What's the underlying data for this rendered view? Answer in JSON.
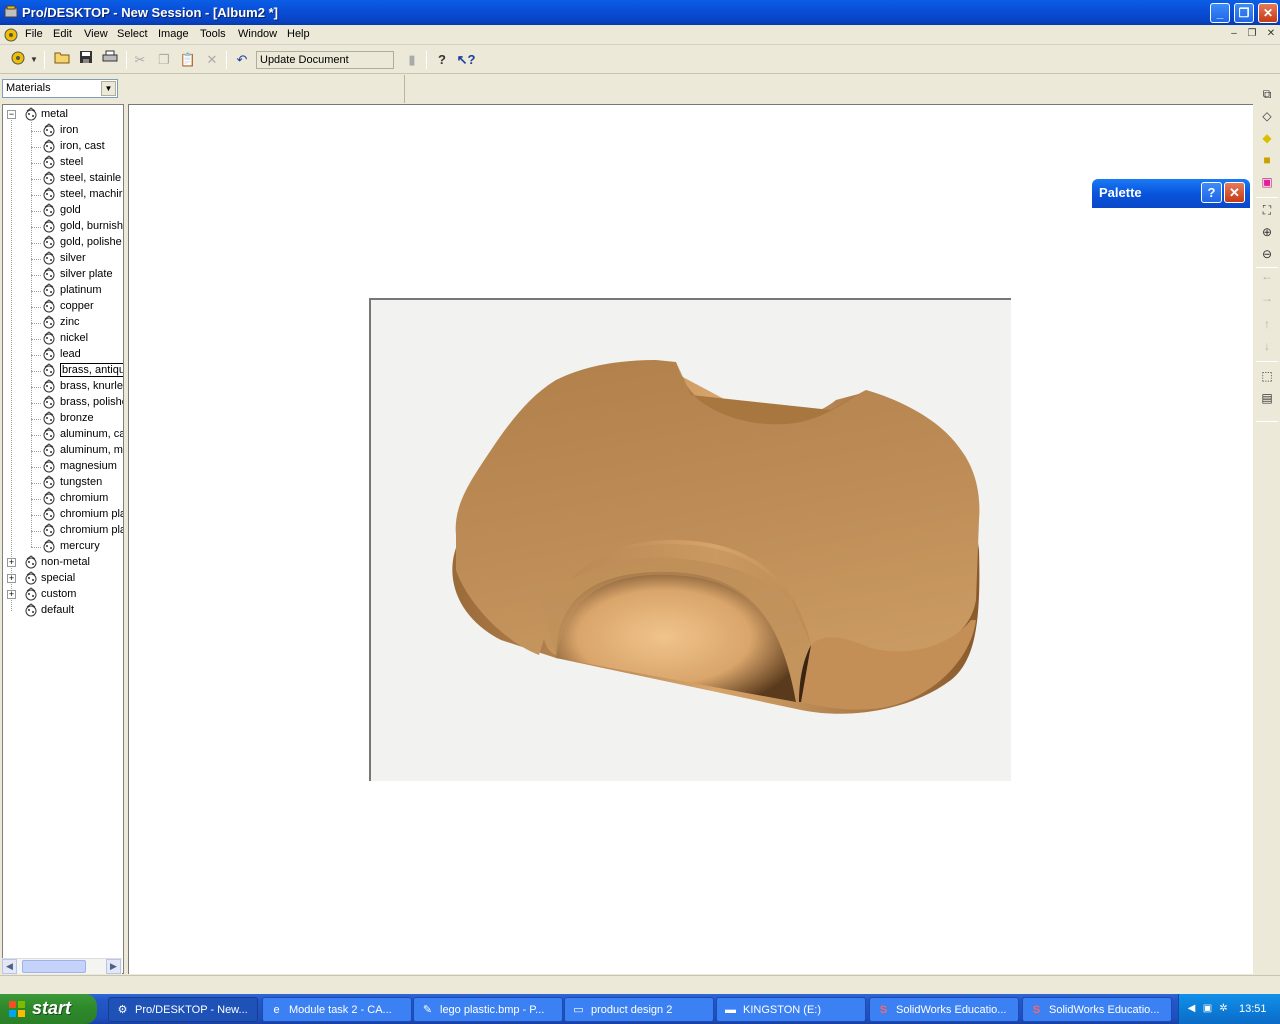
{
  "window": {
    "title": "Pro/DESKTOP - New Session - [Album2 *]",
    "controls": {
      "minimize": "_",
      "maximize": "❐",
      "close": "✕"
    }
  },
  "menu": {
    "items": [
      "File",
      "Edit",
      "View",
      "Select",
      "Image",
      "Tools",
      "Window",
      "Help"
    ],
    "mdi_controls": {
      "minimize": "–",
      "restore": "❐",
      "close": "✕"
    }
  },
  "toolbar": {
    "update_document": "Update Document"
  },
  "materials_combo": {
    "selected": "Materials"
  },
  "tree": {
    "groups": [
      {
        "label": "metal",
        "expanded": true,
        "children": [
          "iron",
          "iron, cast",
          "steel",
          "steel, stainle",
          "steel, machir",
          "gold",
          "gold, burnish",
          "gold, polishe",
          "silver",
          "silver plate",
          "platinum",
          "copper",
          "zinc",
          "nickel",
          "lead",
          "brass, antique",
          "brass, knurle",
          "brass, polishe",
          "bronze",
          "aluminum, ca",
          "aluminum, ma",
          "magnesium",
          "tungsten",
          "chromium",
          "chromium pla",
          "chromium pla",
          "mercury"
        ]
      },
      {
        "label": "non-metal",
        "expanded": false
      },
      {
        "label": "special",
        "expanded": false
      },
      {
        "label": "custom",
        "expanded": false
      },
      {
        "label": "default",
        "expanded": false
      }
    ],
    "selected_item": "brass, antique"
  },
  "palette": {
    "title": "Palette",
    "help": "?",
    "close": "✕"
  },
  "render": {
    "material_color": "#c8935a",
    "background": "#f2f2f0"
  },
  "taskbar": {
    "start_label": "start",
    "tasks": [
      {
        "label": "Pro/DESKTOP - New...",
        "icon": "prodesktop-icon",
        "active": true
      },
      {
        "label": "Module task 2 - CA...",
        "icon": "ie-icon",
        "active": false
      },
      {
        "label": "lego plastic.bmp - P...",
        "icon": "paint-icon",
        "active": false
      },
      {
        "label": "product design 2",
        "icon": "folder-icon",
        "active": false
      },
      {
        "label": "KINGSTON (E:)",
        "icon": "drive-icon",
        "active": false
      },
      {
        "label": "SolidWorks Educatio...",
        "icon": "solidworks-icon",
        "active": false
      },
      {
        "label": "SolidWorks Educatio...",
        "icon": "solidworks-icon",
        "active": false
      }
    ],
    "clock": "13:51"
  }
}
